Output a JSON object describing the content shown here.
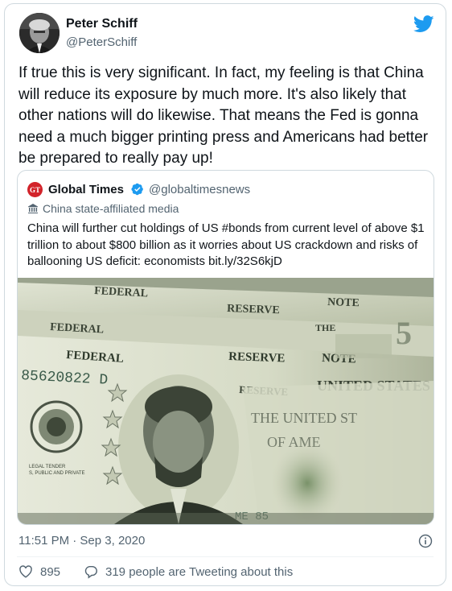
{
  "tweet": {
    "author_name": "Peter Schiff",
    "author_handle": "@PeterSchiff",
    "text": "If true this is very significant. In fact, my feeling is that China will reduce its exposure by much more. It's also likely that other nations will do likewise. That means the Fed is gonna need a much bigger printing press and Americans had better be prepared to really pay up!",
    "timestamp": "11:51 PM · Sep 3, 2020",
    "like_count": "895",
    "conversation_text": "319 people are Tweeting about this"
  },
  "quoted_tweet": {
    "logo_text": "GT",
    "author_name": "Global Times",
    "author_handle": "@globaltimesnews",
    "affiliation_label": "China state-affiliated media",
    "text": "China will further cut holdings of US #bonds from current level of above $1 trillion to about $800 billion as it worries about US crackdown and risks of ballooning US deficit: economists bit.ly/32S6kjD",
    "image_text": {
      "federal_reserve_note": "FEDERAL RESERVE NOTE",
      "federal": "FEDERAL",
      "reserve": "RESERVE",
      "note": "NOTE",
      "serial": "85620822 D",
      "united_states": "UNITED STATES",
      "the": "THE",
      "united_st": "THE UNITED ST",
      "of_ame": "OF AME",
      "legal_tender": "LEGAL TENDER\nS, PUBLIC AND PRIVATE",
      "serial_partial": "ME 85"
    }
  },
  "colors": {
    "brand_blue": "#1d9bf0",
    "gt_red": "#d2232a",
    "muted_text": "#536471",
    "border": "#cfd9de"
  },
  "icons": {
    "brand": "twitter-bird-icon",
    "verified": "verified-badge-icon",
    "affiliation": "state-media-flag-icon",
    "info": "info-icon",
    "like": "heart-icon",
    "conversation": "speech-bubble-icon"
  }
}
